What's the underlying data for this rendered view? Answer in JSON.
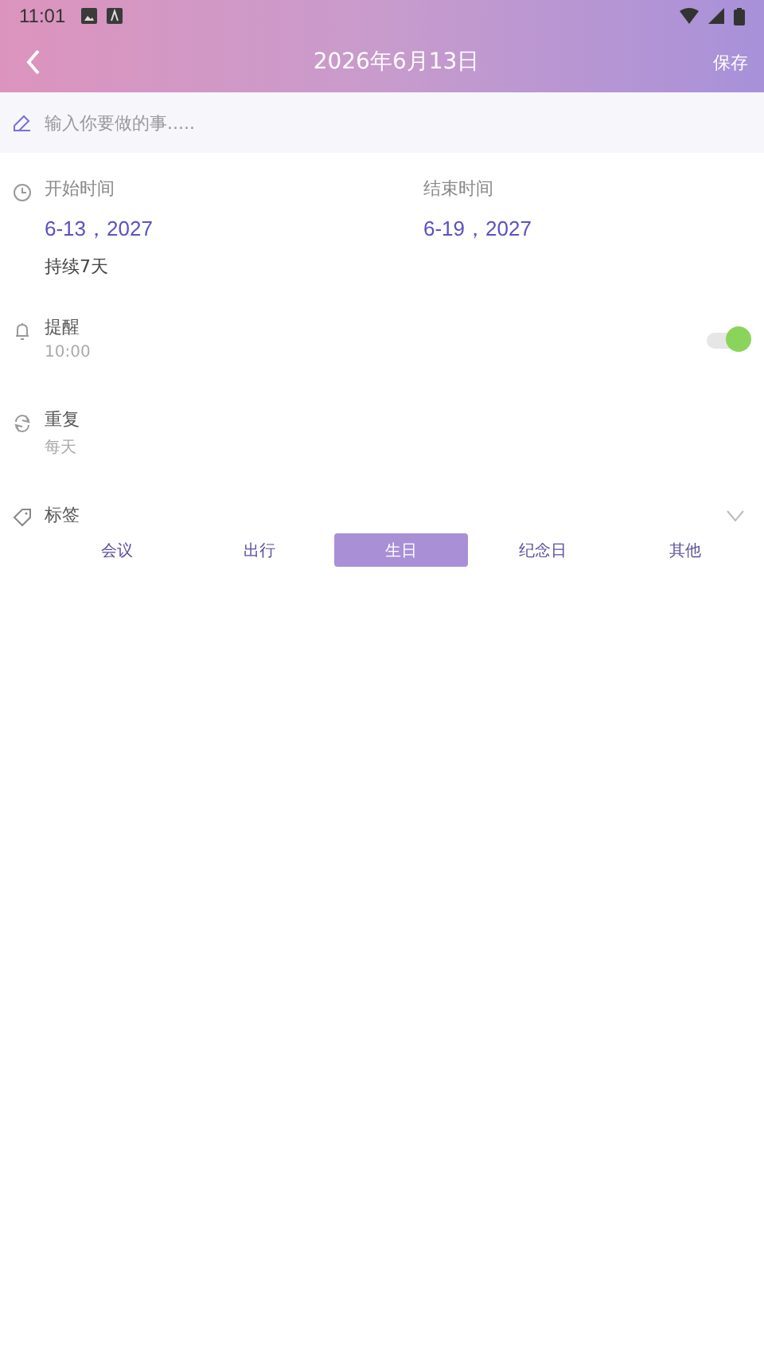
{
  "status_bar": {
    "time": "11:01"
  },
  "header": {
    "title": "2026年6月13日",
    "action": "保存"
  },
  "task_field": {
    "placeholder": "输入你要做的事....."
  },
  "time": {
    "start_label": "开始时间",
    "start_value": "6-13，2027",
    "end_label": "结束时间",
    "end_value": "6-19，2027",
    "duration": "持续7天"
  },
  "reminder": {
    "label": "提醒",
    "value": "10:00",
    "on": true
  },
  "repeat": {
    "label": "重复",
    "value": "每天"
  },
  "tags": {
    "label": "标签",
    "expanded": false,
    "items": [
      {
        "label": "会议",
        "selected": false
      },
      {
        "label": "出行",
        "selected": false
      },
      {
        "label": "生日",
        "selected": true
      },
      {
        "label": "纪念日",
        "selected": false
      },
      {
        "label": "其他",
        "selected": false
      }
    ]
  }
}
